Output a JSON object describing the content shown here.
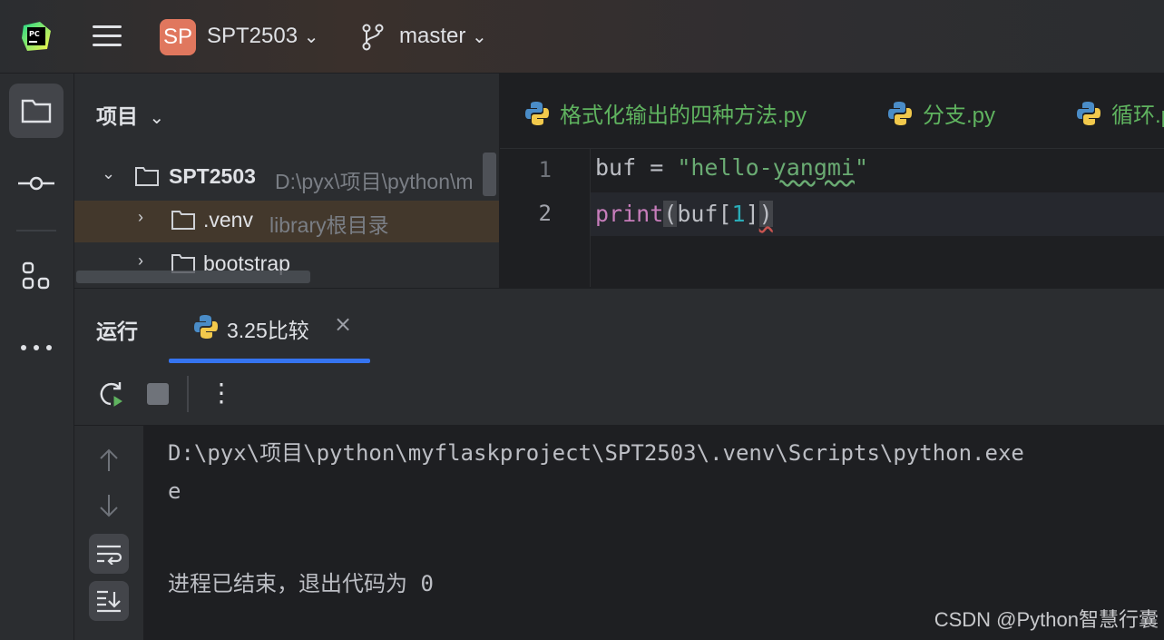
{
  "header": {
    "project_badge": "SP",
    "project_name": "SPT2503",
    "branch": "master"
  },
  "project_panel": {
    "title": "项目",
    "tree": [
      {
        "name": "SPT2503",
        "hint": "D:\\pyx\\项目\\python\\m"
      },
      {
        "name": ".venv",
        "hint": "library根目录"
      },
      {
        "name": "bootstrap",
        "hint": ""
      }
    ]
  },
  "editor": {
    "tabs": [
      "格式化输出的四种方法.py",
      "分支.py",
      "循环.py"
    ],
    "line_numbers": [
      "1",
      "2"
    ],
    "code": {
      "l1_var": "buf",
      "l1_eq": " = ",
      "l1_str_open": "\"hello-",
      "l1_str_typo": "yangmi",
      "l1_str_close": "\"",
      "l2_func": "print",
      "l2_open": "(",
      "l2_arg": "buf[",
      "l2_num": "1",
      "l2_close_b": "]",
      "l2_close_p": ")"
    }
  },
  "run_panel": {
    "title": "运行",
    "tab_label": "3.25比较",
    "close_glyph": "×",
    "menu_glyph": "⋮"
  },
  "console": {
    "lines": [
      "D:\\pyx\\项目\\python\\myflaskproject\\SPT2503\\.venv\\Scripts\\python.exe",
      "e",
      "进程已结束，退出代码为 0"
    ]
  },
  "watermark": "CSDN @Python智慧行囊",
  "colors": {
    "accent": "#3574f0",
    "badge": "#e0775e",
    "python_tab_text": "#5fb35f",
    "selection": "#43382c"
  }
}
